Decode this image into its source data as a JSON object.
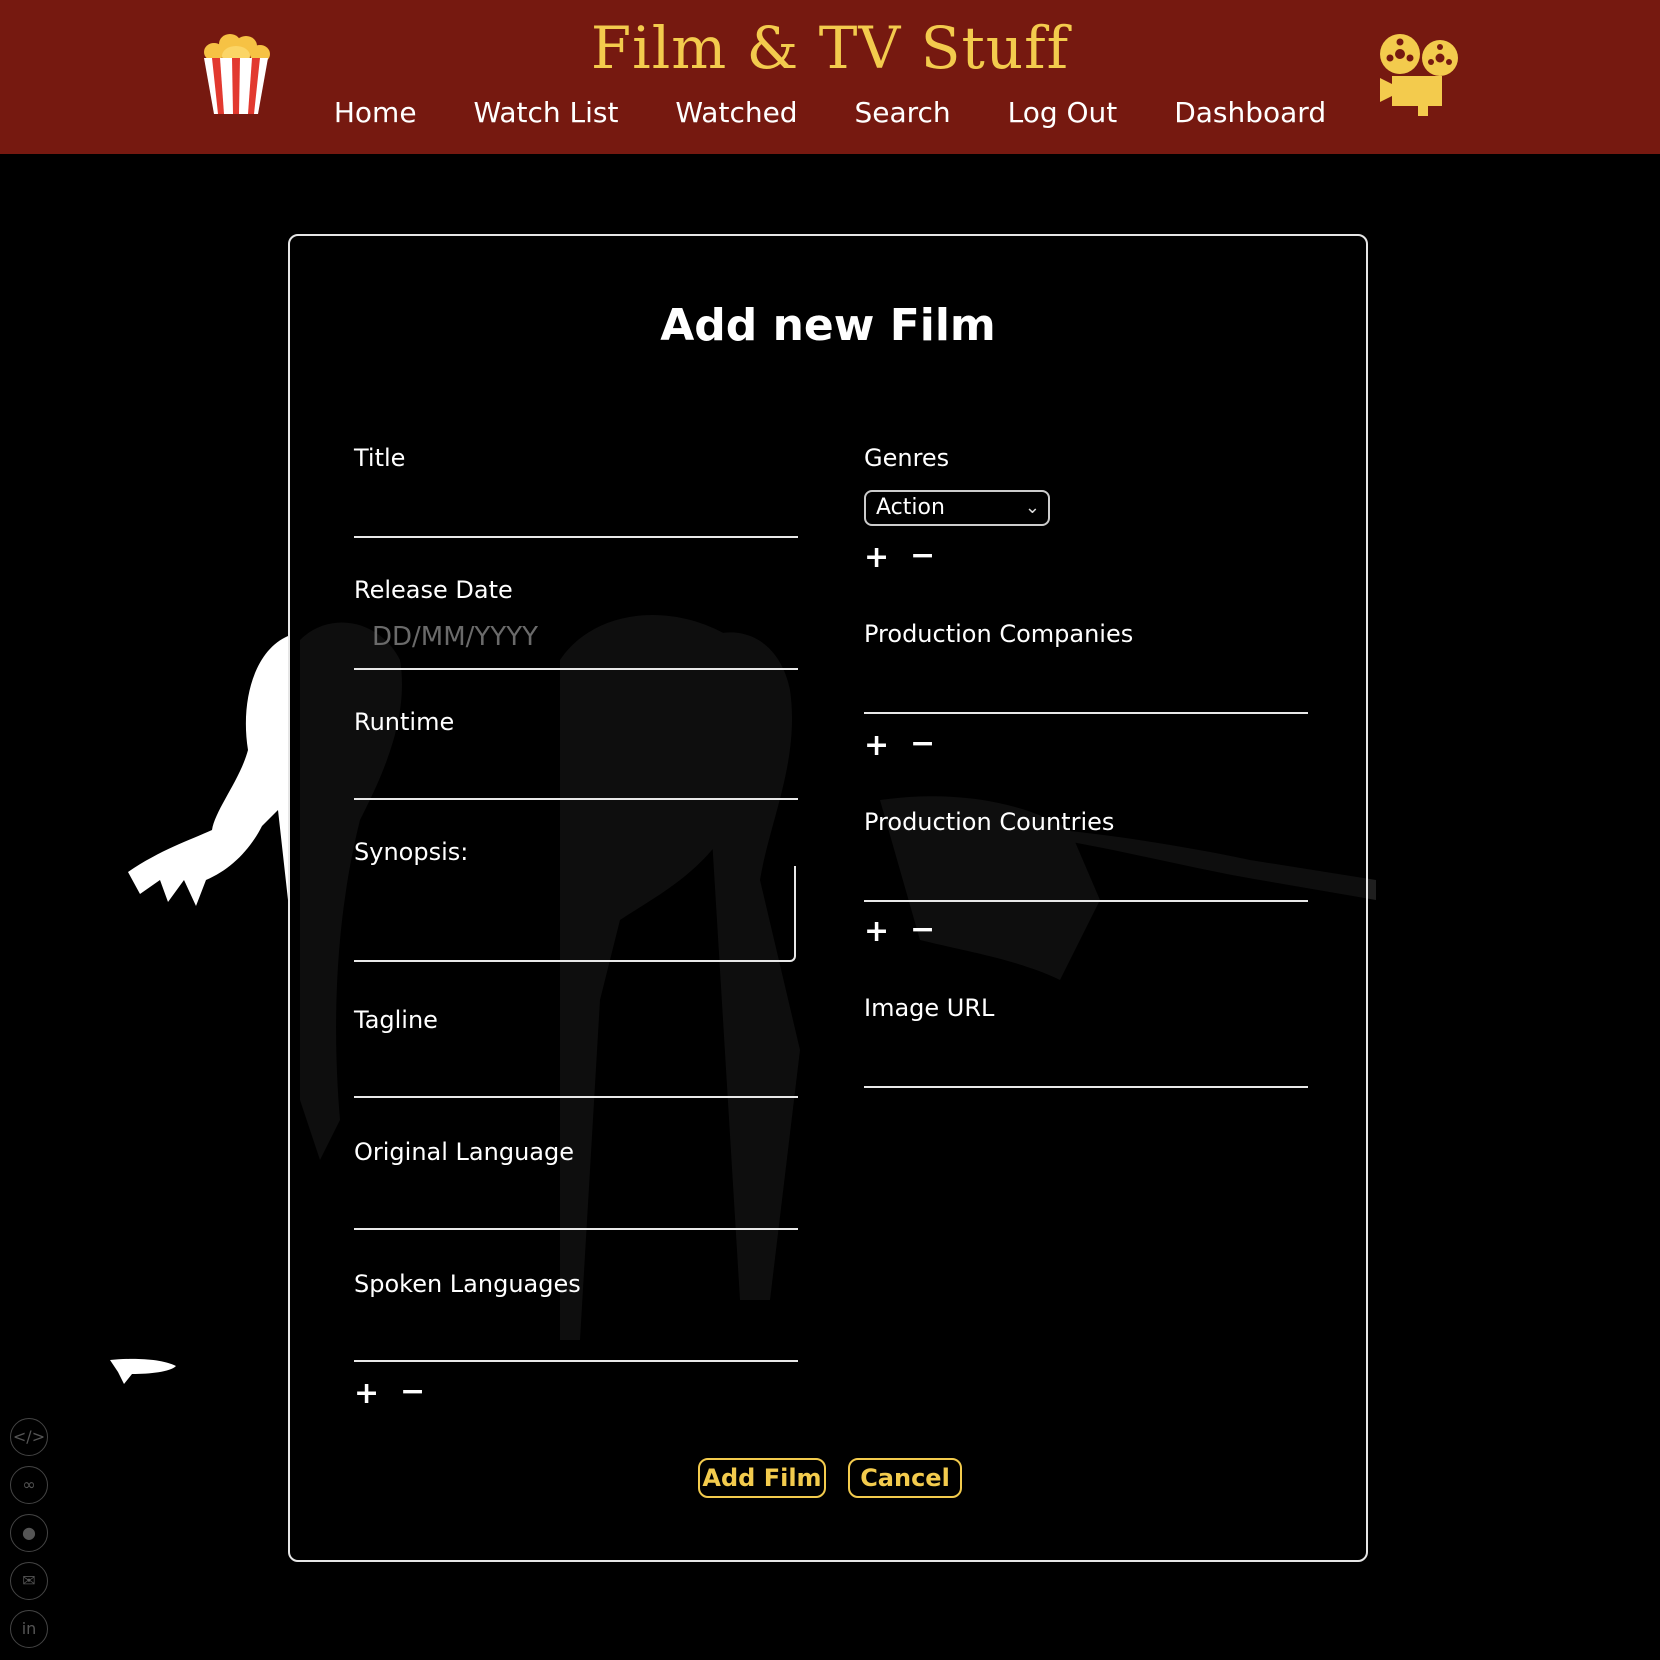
{
  "header": {
    "site_title": "Film & TV Stuff",
    "nav": [
      "Home",
      "Watch List",
      "Watched",
      "Search",
      "Log Out",
      "Dashboard"
    ]
  },
  "form": {
    "title": "Add new Film",
    "fields": {
      "title": "Title",
      "release_date": "Release Date",
      "release_date_placeholder": "DD/MM/YYYY",
      "runtime": "Runtime",
      "synopsis": "Synopsis:",
      "tagline": "Tagline",
      "original_language": "Original Language",
      "spoken_languages": "Spoken Languages",
      "genres": "Genres",
      "genre_selected": "Action",
      "production_companies": "Production Companies",
      "production_countries": "Production Countries",
      "image_url": "Image URL"
    },
    "plus": "+",
    "minus": "−",
    "add_button": "Add Film",
    "cancel_button": "Cancel"
  },
  "social_icons": [
    "code-icon",
    "link-icon",
    "github-icon",
    "mail-icon",
    "linkedin-icon"
  ],
  "colors": {
    "header_bg": "#761910",
    "accent": "#f3cb4d",
    "background": "#000000"
  }
}
